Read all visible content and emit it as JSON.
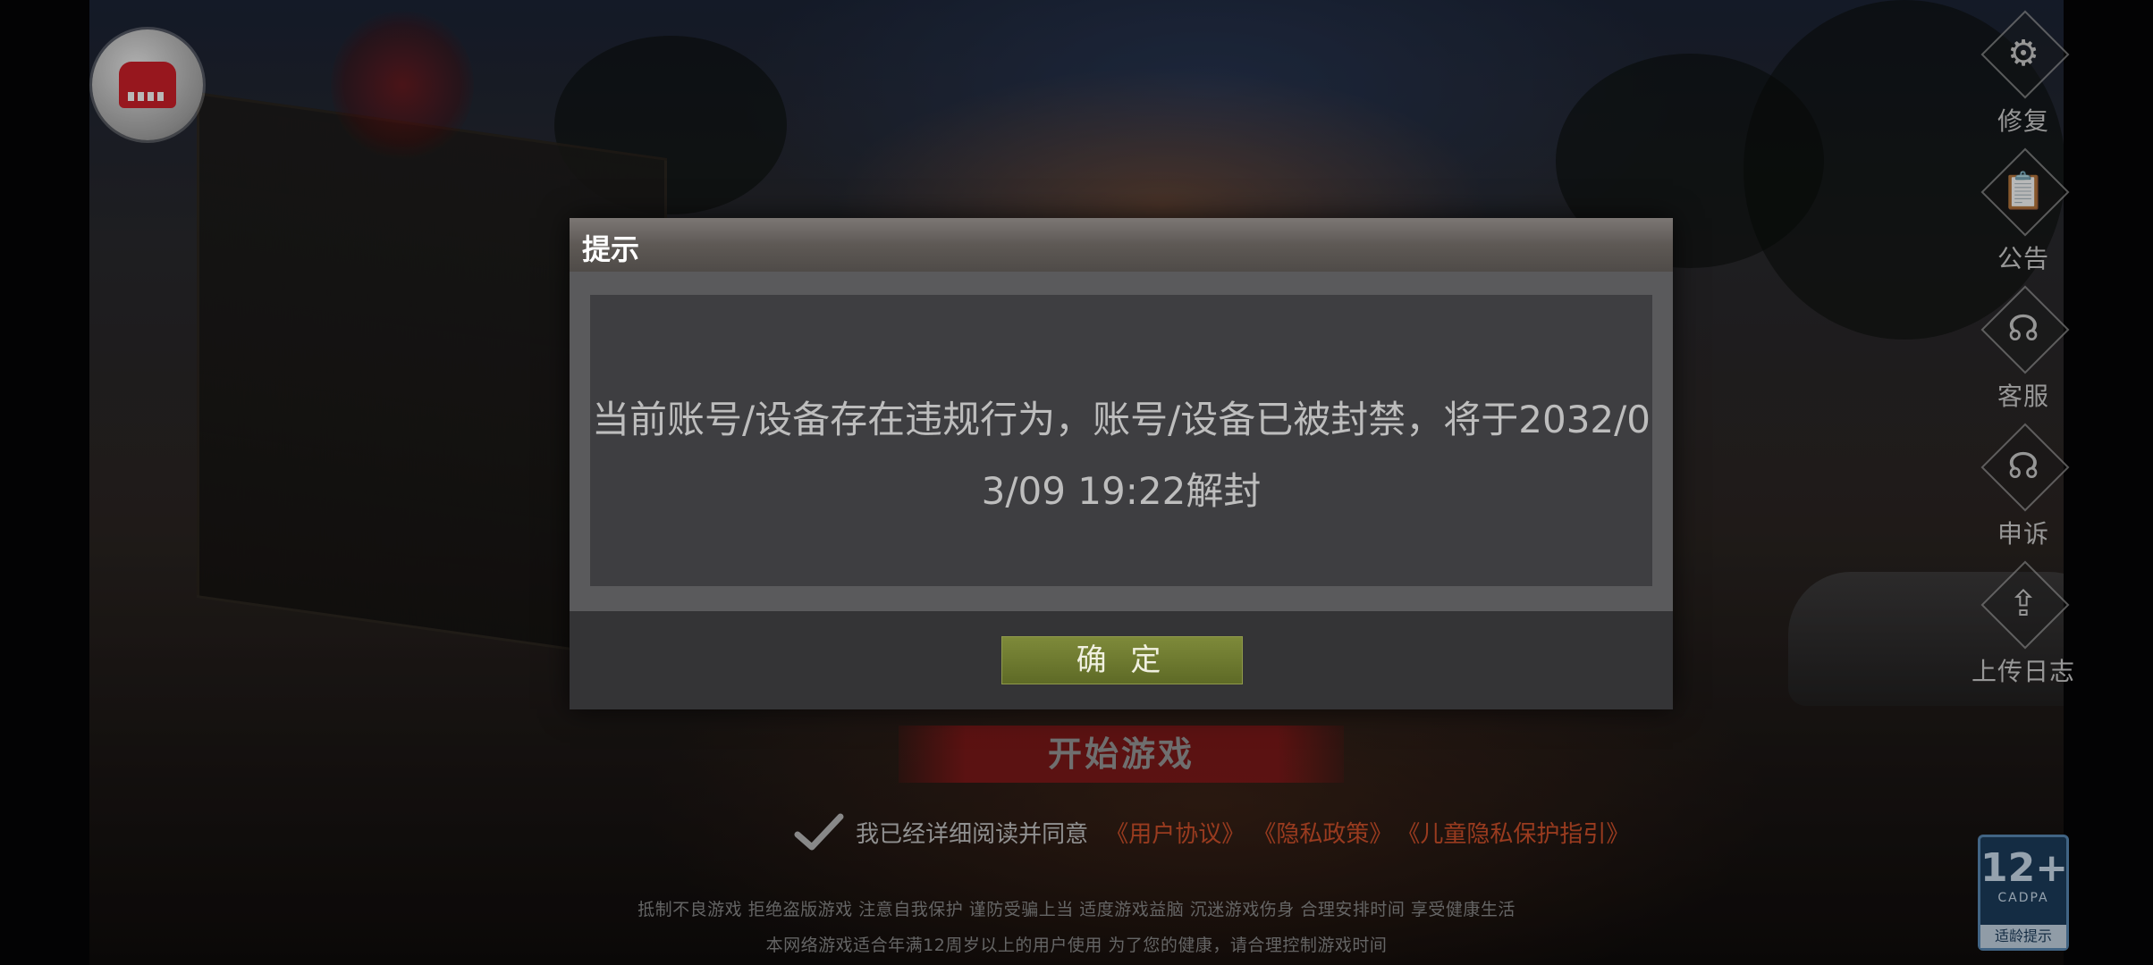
{
  "dialog": {
    "title": "提示",
    "message": "当前账号/设备存在违规行为，账号/设备已被封禁，将于2032/03/09 19:22解封",
    "confirm_label": "确 定"
  },
  "toolbar": {
    "items": [
      {
        "label": "修复",
        "icon": "gears-icon"
      },
      {
        "label": "公告",
        "icon": "notice-icon"
      },
      {
        "label": "客服",
        "icon": "headset-icon"
      },
      {
        "label": "申诉",
        "icon": "appeal-icon"
      },
      {
        "label": "上传日志",
        "icon": "upload-icon"
      }
    ]
  },
  "start_button_label": "开始游戏",
  "agreement": {
    "checked": true,
    "text": "我已经详细阅读并同意",
    "links": [
      "《用户协议》",
      "《隐私政策》",
      "《儿童隐私保护指引》"
    ]
  },
  "notices": {
    "line1": "抵制不良游戏 拒绝盗版游戏 注意自我保护 谨防受骗上当 适度游戏益脑 沉迷游戏伤身 合理安排时间 享受健康生活",
    "line2": "本网络游戏适合年满12周岁以上的用户使用   为了您的健康，请合理控制游戏时间"
  },
  "age_rating": {
    "age": "12+",
    "org": "CADPA",
    "tip": "适龄提示"
  },
  "colors": {
    "link": "#d4532c",
    "confirm": "#6f7b30",
    "start": "#8c1919",
    "age_badge": "#1d3d5e"
  }
}
